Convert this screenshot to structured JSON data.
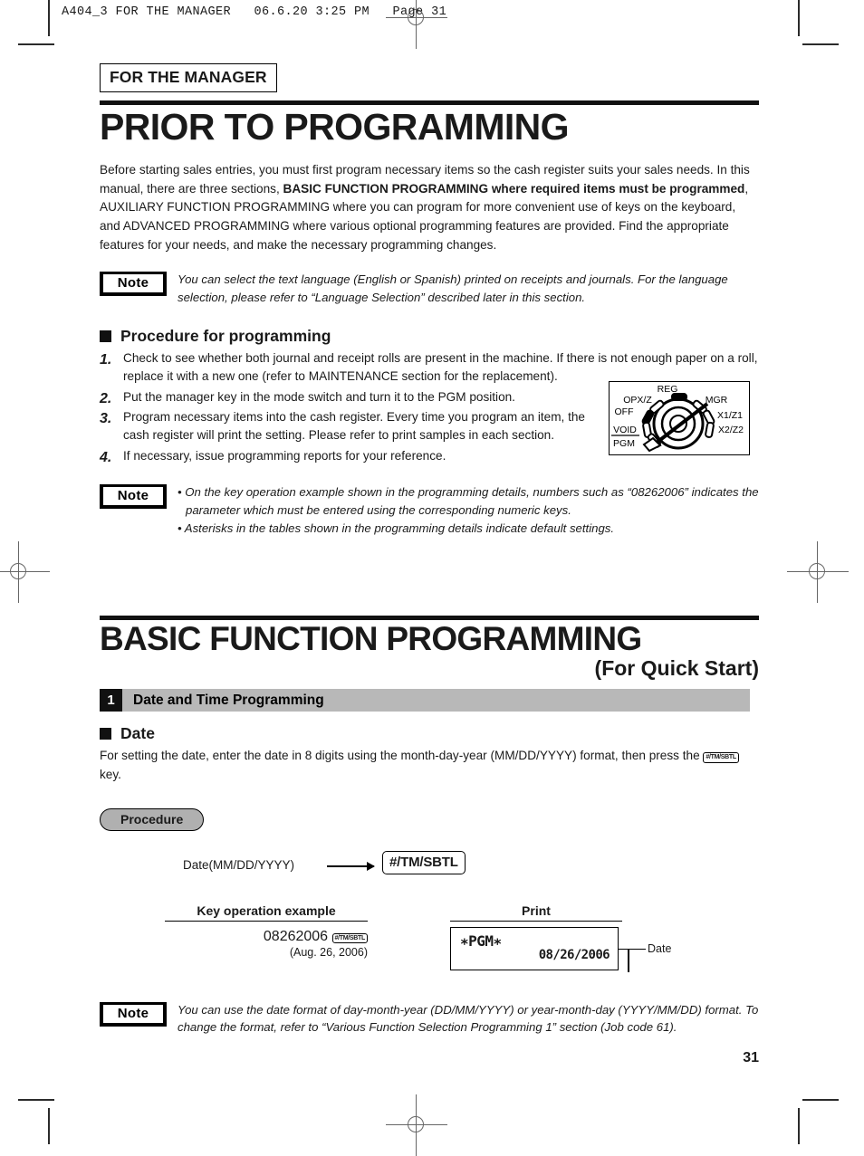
{
  "print_header": "A404_3 FOR THE MANAGER   06.6.20 3:25 PM   Page 31",
  "manager_tag": "FOR THE MANAGER",
  "title": "PRIOR TO PROGRAMMING",
  "intro": {
    "part1": "Before starting sales entries, you must first program necessary items so the cash register suits your sales needs.  In this manual, there are three sections, ",
    "bold1": "BASIC FUNCTION PROGRAMMING where required items must be programmed",
    "part2": ", AUXILIARY FUNCTION PROGRAMMING where you can program for more convenient use of keys on the keyboard, and ADVANCED PROGRAMMING where various optional programming features are provided.  Find the appropriate features for your needs, and make the necessary programming changes."
  },
  "note_label": "Note",
  "note1": "You can select the text language (English or Spanish) printed on receipts and journals.  For the language selection, please refer to “Language Selection” described later in this section.",
  "procedure_heading": "Procedure for programming",
  "steps": [
    {
      "num": "1.",
      "text": "Check to see whether both journal and receipt rolls are present in the machine.  If there is not enough paper on a roll, replace it with a new one (refer to MAINTENANCE section for the replacement)."
    },
    {
      "num": "2.",
      "text": "Put the manager key in the mode switch and turn it to the PGM position."
    },
    {
      "num": "3.",
      "text": "Program necessary items into the cash register. Every time you program an item, the cash register will print the setting.  Please refer to print samples in each section."
    },
    {
      "num": "4.",
      "text": "If necessary, issue programming reports for your reference."
    }
  ],
  "mode_switch": {
    "positions": [
      "REG",
      "OPX/Z",
      "MGR",
      "OFF",
      "X1/Z1",
      "VOID",
      "X2/Z2",
      "PGM"
    ],
    "selected": "PGM"
  },
  "note2": {
    "bullet1": "• On the key operation example shown in the programming details, numbers such as “08262006” indicates the parameter which must be entered using the corresponding numeric keys.",
    "bullet2": "• Asterisks in the tables shown in the programming details indicate default settings."
  },
  "section2": {
    "title": "BASIC FUNCTION PROGRAMMING",
    "subtitle": "(For Quick Start)",
    "bar_number": "1",
    "bar_label": "Date and Time Programming"
  },
  "date_block": {
    "heading": "Date",
    "body_before_key": "For setting the date, enter the date in 8 digits using the month-day-year (MM/DD/YYYY) format, then press the ",
    "key_label": "#/TM/SBTL",
    "body_after_key": " key."
  },
  "procedure_pill": "Procedure",
  "flow": {
    "input_label": "Date(MM/DD/YYYY)",
    "key_label": "#/TM/SBTL"
  },
  "columns": {
    "left_header": "Key operation example",
    "right_header": "Print",
    "example_value": "08262006",
    "example_key": "#/TM/SBTL",
    "example_sub": "(Aug. 26, 2006)"
  },
  "receipt": {
    "pgm_line": "∗PGM∗",
    "date_line": "08/26/2006",
    "callout": "Date"
  },
  "note3": "You can use the date format of day-month-year (DD/MM/YYYY) or year-month-day (YYYY/MM/DD) format.  To change the format, refer to “Various Function Selection Programming 1” section (Job code 61).",
  "page_number": "31"
}
